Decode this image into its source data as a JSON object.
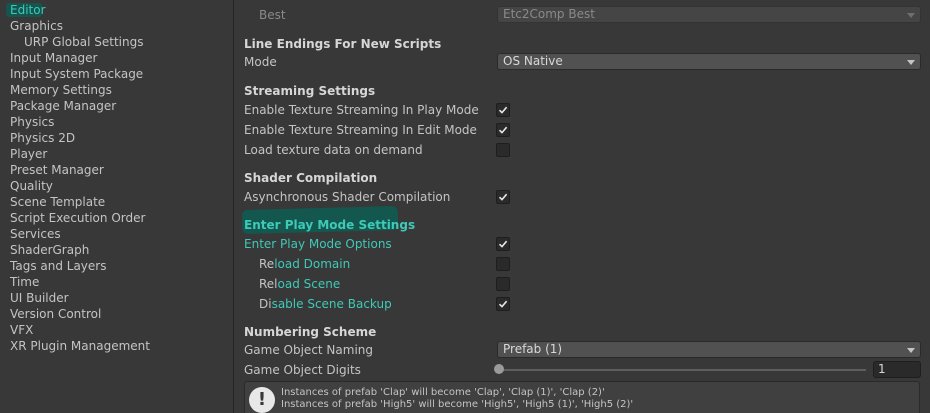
{
  "sidebar": {
    "items": [
      {
        "label": "Editor",
        "child": false,
        "selected": true
      },
      {
        "label": "Graphics",
        "child": false
      },
      {
        "label": "URP Global Settings",
        "child": true
      },
      {
        "label": "Input Manager",
        "child": false
      },
      {
        "label": "Input System Package",
        "child": false
      },
      {
        "label": "Memory Settings",
        "child": false
      },
      {
        "label": "Package Manager",
        "child": false
      },
      {
        "label": "Physics",
        "child": false
      },
      {
        "label": "Physics 2D",
        "child": false
      },
      {
        "label": "Player",
        "child": false
      },
      {
        "label": "Preset Manager",
        "child": false
      },
      {
        "label": "Quality",
        "child": false
      },
      {
        "label": "Scene Template",
        "child": false
      },
      {
        "label": "Script Execution Order",
        "child": false
      },
      {
        "label": "Services",
        "child": false
      },
      {
        "label": "ShaderGraph",
        "child": false
      },
      {
        "label": "Tags and Layers",
        "child": false
      },
      {
        "label": "Time",
        "child": false
      },
      {
        "label": "UI Builder",
        "child": false
      },
      {
        "label": "Version Control",
        "child": false
      },
      {
        "label": "VFX",
        "child": false
      },
      {
        "label": "XR Plugin Management",
        "child": false
      }
    ]
  },
  "main": {
    "best": {
      "label": "Best",
      "value": "Etc2Comp Best"
    },
    "line_endings": {
      "header": "Line Endings For New Scripts",
      "mode_label": "Mode",
      "mode_value": "OS Native"
    },
    "streaming": {
      "header": "Streaming Settings",
      "play_mode_label": "Enable Texture Streaming In Play Mode",
      "play_mode_checked": true,
      "edit_mode_label": "Enable Texture Streaming In Edit Mode",
      "edit_mode_checked": true,
      "on_demand_label": "Load texture data on demand",
      "on_demand_checked": false
    },
    "shader": {
      "header": "Shader Compilation",
      "async_label": "Asynchronous Shader Compilation",
      "async_checked": true
    },
    "play_mode": {
      "header": "Enter Play Mode Settings",
      "options_label": "Enter Play Mode Options",
      "options_checked": true,
      "reload_domain_label_a": "Re",
      "reload_domain_label_b": "load Domain",
      "reload_domain_checked": false,
      "reload_scene_label_a": "Rel",
      "reload_scene_label_b": "oad Scene",
      "reload_scene_checked": false,
      "disable_backup_label_a": "Di",
      "disable_backup_label_b": "sable Scene Backup",
      "disable_backup_checked": true
    },
    "numbering": {
      "header": "Numbering Scheme",
      "naming_label": "Game Object Naming",
      "naming_value": "Prefab (1)",
      "digits_label": "Game Object Digits",
      "digits_value": "1",
      "help_line1": "Instances of prefab 'Clap' will become 'Clap', 'Clap (1)', 'Clap (2)'",
      "help_line2": "Instances of prefab 'High5' will become 'High5', 'High5 (1)', 'High5 (2)'",
      "help_icon_glyph": "!"
    }
  },
  "colors": {
    "background": "#383838",
    "highlight_text": "#3ec9b8",
    "highlight_bg": "#0f5b52"
  }
}
